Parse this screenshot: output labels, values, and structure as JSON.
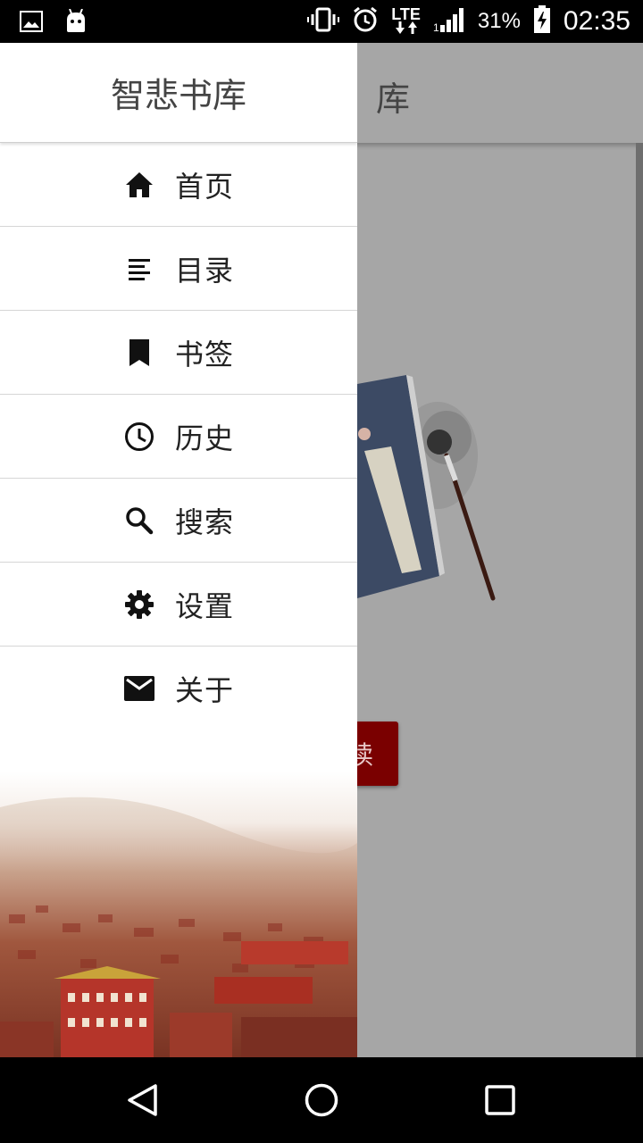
{
  "status_bar": {
    "battery": "31%",
    "time": "02:35",
    "network": "LTE",
    "icons": [
      "image-icon",
      "android-icon",
      "vibrate-icon",
      "alarm-icon",
      "lte-icon",
      "signal-icon",
      "battery-charging-icon"
    ]
  },
  "app": {
    "title_fragment": "库",
    "read_button_fragment": "读"
  },
  "drawer": {
    "title": "智悲书库",
    "items": [
      {
        "label": "首页",
        "icon": "home-icon"
      },
      {
        "label": "目录",
        "icon": "list-icon"
      },
      {
        "label": "书签",
        "icon": "bookmark-icon"
      },
      {
        "label": "历史",
        "icon": "history-clock-icon"
      },
      {
        "label": "搜索",
        "icon": "search-icon"
      },
      {
        "label": "设置",
        "icon": "settings-gear-icon"
      },
      {
        "label": "关于",
        "icon": "mail-icon"
      }
    ]
  },
  "nav_bar": {
    "icons": [
      "back-icon",
      "home-circle-icon",
      "recents-icon"
    ]
  },
  "colors": {
    "status_bar": "#000000",
    "scrim": "#a6a6a6",
    "drawer": "#ffffff",
    "button": "#7a0000"
  }
}
